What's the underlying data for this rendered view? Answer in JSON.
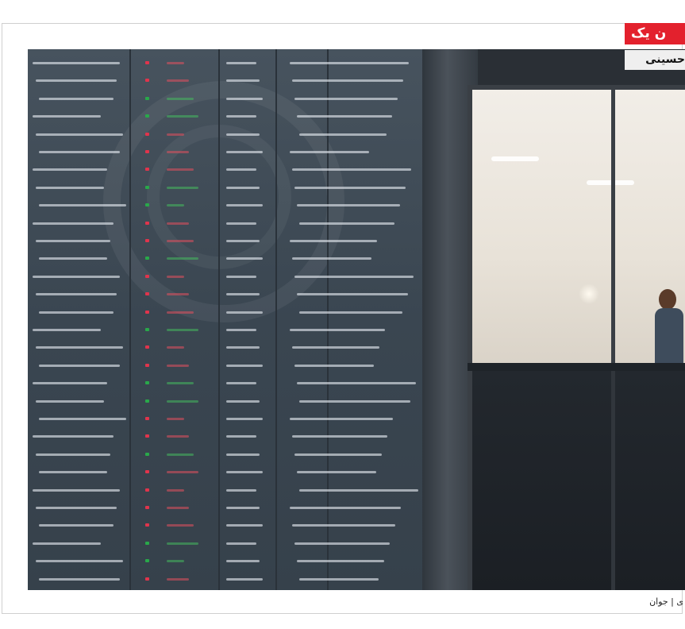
{
  "section_tag": "ن یک",
  "byline": "حسینی",
  "photo_credit": "ی | جوان",
  "photo": {
    "description_icon": "stock-exchange-board-photo",
    "accent_color": "#e3212d"
  }
}
